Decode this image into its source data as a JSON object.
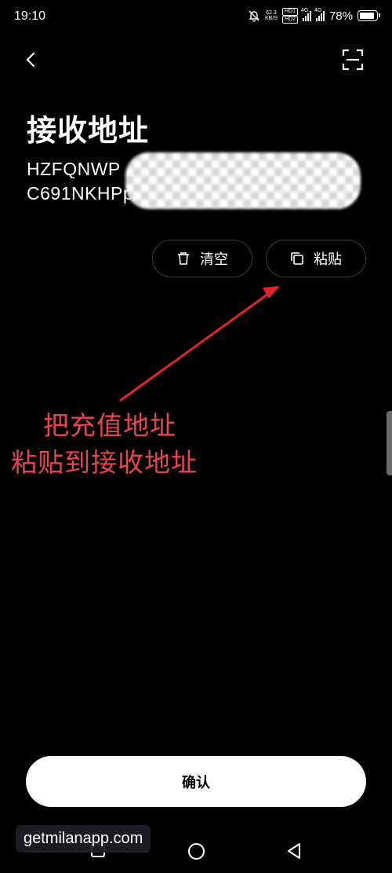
{
  "status_bar": {
    "time": "19:10",
    "net_speed_value": "62.3",
    "net_speed_unit": "KB/S",
    "hd1": "HD1",
    "hd2": "HD2",
    "sim1_net": "4G",
    "sim2_net": "4G",
    "battery": "78%"
  },
  "header": {
    "back_icon": "chevron-left-icon",
    "scan_icon": "scan-icon"
  },
  "page": {
    "title": "接收地址",
    "address": "HZFQNWP\nC691NKHPpk",
    "clear_label": "清空",
    "paste_label": "粘贴",
    "confirm_label": "确认"
  },
  "annotation": {
    "line1": "把充值地址",
    "line2": "粘贴到接收地址",
    "color": "#e9454c"
  },
  "watermark": {
    "text": "getmilanapp.com"
  },
  "nav": {
    "recent_icon": "square-icon",
    "home_icon": "circle-icon",
    "back_icon": "triangle-back-icon"
  }
}
